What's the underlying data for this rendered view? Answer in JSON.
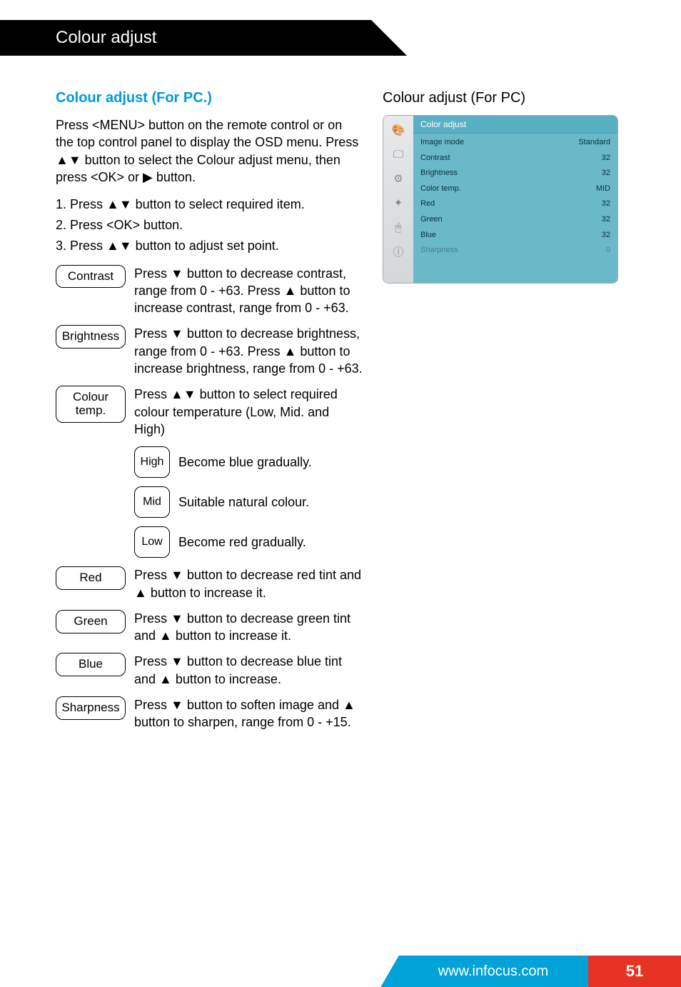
{
  "header": {
    "title": "Colour adjust"
  },
  "left": {
    "subtitle": "Colour adjust (For PC.)",
    "intro": "Press <MENU> button on the remote control or on the top control panel to display the OSD menu. Press ▲▼ button to select the Colour adjust menu, then press <OK> or ▶ button.",
    "steps": [
      "Press ▲▼ button to select required item.",
      "Press <OK> button.",
      "Press ▲▼ button to adjust set point."
    ],
    "items": {
      "contrast": {
        "label": "Contrast",
        "desc": "Press ▼ button to decrease contrast, range from 0 - +63. Press ▲ button to increase contrast, range from 0 - +63."
      },
      "brightness": {
        "label": "Brightness",
        "desc": "Press ▼ button to decrease brightness, range from 0 - +63. Press ▲ button to increase brightness, range from 0 - +63."
      },
      "colortemp": {
        "label": "Colour temp.",
        "desc": "Press ▲▼ button to select required colour temperature (Low, Mid. and High)",
        "sub": {
          "high": {
            "label": "High",
            "desc": "Become blue gradually."
          },
          "mid": {
            "label": "Mid",
            "desc": "Suitable natural colour."
          },
          "low": {
            "label": "Low",
            "desc": "Become red gradually."
          }
        }
      },
      "red": {
        "label": "Red",
        "desc": "Press ▼ button to decrease red tint and ▲ button to increase it."
      },
      "green": {
        "label": "Green",
        "desc": "Press ▼ button to decrease green tint and ▲ button to increase it."
      },
      "blue": {
        "label": "Blue",
        "desc": "Press ▼ button to decrease blue tint and ▲ button to increase."
      },
      "sharp": {
        "label": "Sharpness",
        "desc": "Press ▼ button to soften image and ▲ button to sharpen, range from 0 - +15."
      }
    }
  },
  "right": {
    "title": "Colour adjust (For PC)",
    "osd": {
      "header": "Color adjust",
      "rows": [
        {
          "label": "Image mode",
          "value": "Standard"
        },
        {
          "label": "Contrast",
          "value": "32"
        },
        {
          "label": "Brightness",
          "value": "32"
        },
        {
          "label": "Color temp.",
          "value": "MID"
        },
        {
          "label": "Red",
          "value": "32"
        },
        {
          "label": "Green",
          "value": "32"
        },
        {
          "label": "Blue",
          "value": "32"
        },
        {
          "label": "Sharpness",
          "value": "0",
          "dim": true
        }
      ]
    }
  },
  "footer": {
    "url": "www.infocus.com",
    "page": "51"
  }
}
